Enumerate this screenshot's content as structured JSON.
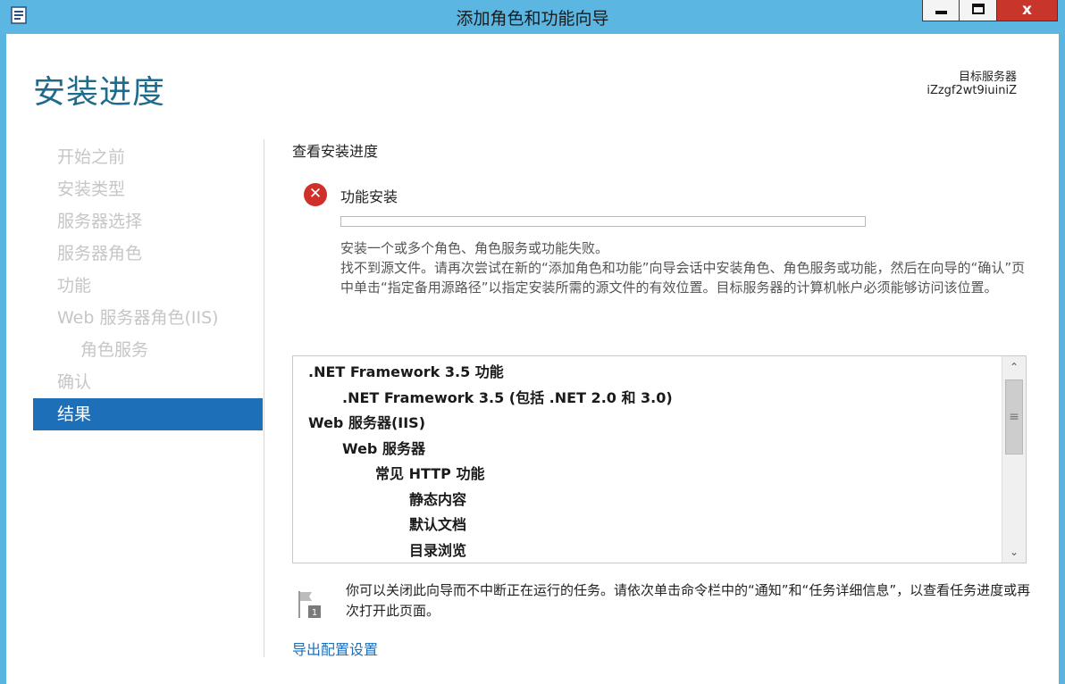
{
  "window": {
    "title": "添加角色和功能向导",
    "close_glyph": "x"
  },
  "header": {
    "page_title": "安装进度",
    "target_server_label": "目标服务器",
    "target_server_name": "iZzgf2wt9iuiniZ"
  },
  "nav": {
    "items": [
      {
        "label": "开始之前"
      },
      {
        "label": "安装类型"
      },
      {
        "label": "服务器选择"
      },
      {
        "label": "服务器角色"
      },
      {
        "label": "功能"
      },
      {
        "label": "Web 服务器角色(IIS)"
      },
      {
        "label": "角色服务"
      },
      {
        "label": "确认"
      },
      {
        "label": "结果"
      }
    ],
    "active": "结果"
  },
  "content": {
    "section_title": "查看安装进度",
    "status": {
      "icon": "error-icon",
      "title": "功能安装",
      "progress": 0,
      "message_line1": "安装一个或多个角色、角色服务或功能失败。",
      "message_line2": "找不到源文件。请再次尝试在新的“添加角色和功能”向导会话中安装角色、角色服务或功能，然后在向导的“确认”页中单击“指定备用源路径”以指定安装所需的源文件的有效位置。目标服务器的计算机帐户必须能够访问该位置。"
    },
    "features": [
      {
        "label": ".NET Framework 3.5 功能",
        "level": 0
      },
      {
        "label": ".NET Framework 3.5 (包括 .NET 2.0 和 3.0)",
        "level": 1
      },
      {
        "label": "Web 服务器(IIS)",
        "level": 0
      },
      {
        "label": "Web 服务器",
        "level": 1
      },
      {
        "label": "常见 HTTP 功能",
        "level": 2
      },
      {
        "label": "静态内容",
        "level": 3
      },
      {
        "label": "默认文档",
        "level": 3
      },
      {
        "label": "目录浏览",
        "level": 3
      }
    ],
    "notice": "你可以关闭此向导而不中断正在运行的任务。请依次单击命令栏中的“通知”和“任务详细信息”，以查看任务进度或再次打开此页面。",
    "export_link": "导出配置设置"
  },
  "colors": {
    "title_bar": "#5bb6e2",
    "accent": "#1d6fb8",
    "page_title": "#1f6b8c",
    "error": "#d0302a",
    "close_button": "#c7352b"
  }
}
